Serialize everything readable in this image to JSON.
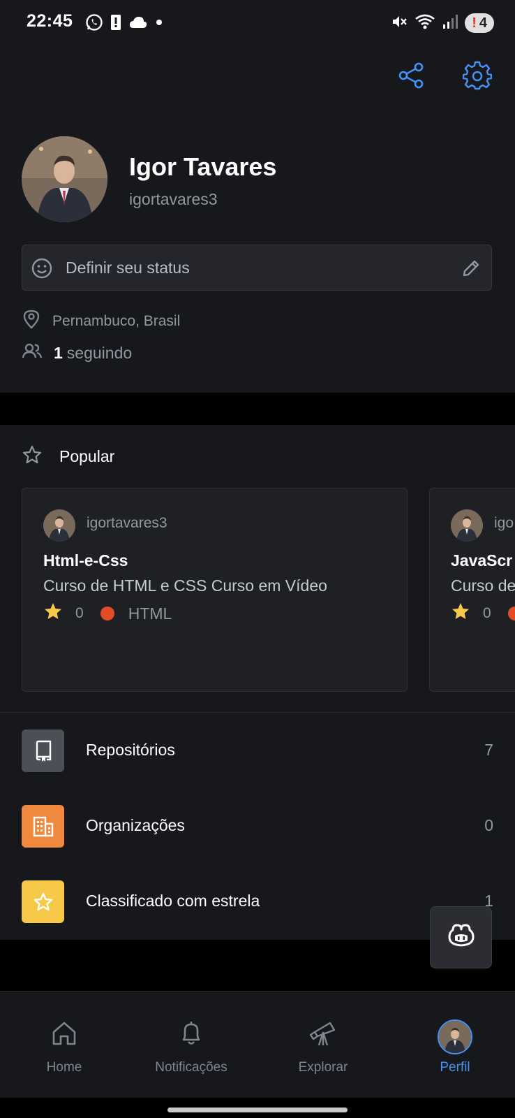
{
  "status_bar": {
    "time": "22:45",
    "left_icons": [
      "whatsapp-icon",
      "alert-icon",
      "cloud-icon",
      "dot-icon"
    ],
    "right_icons": [
      "mute-icon",
      "wifi-icon",
      "signal-icon"
    ],
    "badge_count": "4"
  },
  "header_actions": {
    "share_icon": "share-icon",
    "settings_icon": "gear-icon"
  },
  "profile": {
    "name": "Igor Tavares",
    "login": "igortavares3",
    "status_placeholder": "Definir seu status",
    "location": "Pernambuco, Brasil",
    "following_count": "1",
    "following_label": "seguindo"
  },
  "popular": {
    "title": "Popular",
    "cards": [
      {
        "owner": "igortavares3",
        "repo": "Html-e-Css",
        "description": "Curso de HTML e CSS Curso em Vídeo",
        "stars": "0",
        "language": "HTML",
        "language_color": "#e34c26"
      },
      {
        "owner": "igo",
        "repo": "JavaScr",
        "description": "Curso de",
        "stars": "0",
        "language": "",
        "language_color": "#e34c26"
      }
    ]
  },
  "lists": [
    {
      "label": "Repositórios",
      "count": "7",
      "icon": "repo-icon",
      "color": "#4d4f57"
    },
    {
      "label": "Organizações",
      "count": "0",
      "icon": "organization-icon",
      "color": "#f0883e"
    },
    {
      "label": "Classificado com estrela",
      "count": "1",
      "icon": "star-icon",
      "color": "#f7c948"
    }
  ],
  "nav": [
    {
      "label": "Home",
      "icon": "home-icon"
    },
    {
      "label": "Notificações",
      "icon": "bell-icon"
    },
    {
      "label": "Explorar",
      "icon": "telescope-icon"
    },
    {
      "label": "Perfil",
      "icon": "avatar"
    }
  ],
  "colors": {
    "background": "#17181c",
    "accent": "#4493f8"
  }
}
